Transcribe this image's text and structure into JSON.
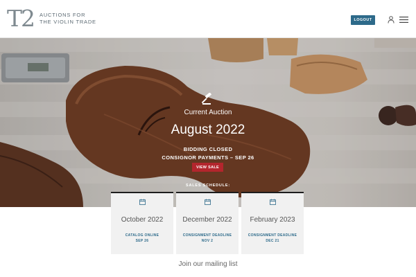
{
  "header": {
    "logo_mark": "T2",
    "logo_line1": "AUCTIONS FOR",
    "logo_line2": "THE VIOLIN TRADE",
    "logout_label": "LOGOUT"
  },
  "hero": {
    "label": "Current Auction",
    "title": "August 2022",
    "status": "BIDDING CLOSED",
    "sub": "CONSIGNOR PAYMENTS – SEP 26",
    "button_label": "VIEW SALE",
    "schedule_label": "SALES SCHEDULE:"
  },
  "schedule": [
    {
      "title": "October 2022",
      "line1": "CATALOG ONLINE",
      "line2": "SEP 26"
    },
    {
      "title": "December 2022",
      "line1": "CONSIGNMENT DEADLINE",
      "line2": "NOV 2"
    },
    {
      "title": "February 2023",
      "line1": "CONSIGNMENT DEADLINE",
      "line2": "DEC 21"
    }
  ],
  "footer": {
    "mailing_label": "Join our mailing list"
  },
  "colors": {
    "accent": "#2d6a8a",
    "button_red": "#b3262d",
    "card_bg": "#f1f1f1"
  },
  "icons": [
    "user-icon",
    "menu-icon",
    "gavel-icon",
    "calendar-icon"
  ]
}
